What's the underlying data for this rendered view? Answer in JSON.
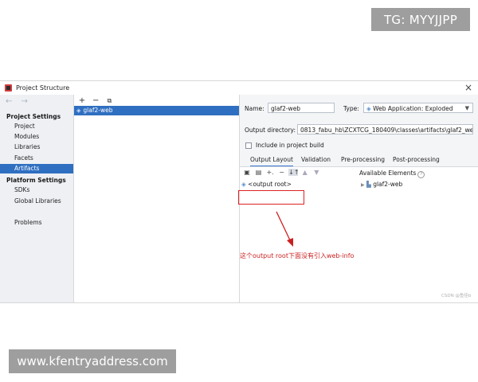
{
  "watermarks": {
    "top_right": "TG: MYYJJPP",
    "bottom_left": "www.kfentryaddress.com"
  },
  "window": {
    "title": "Project Structure",
    "close": "×"
  },
  "nav": {
    "arrows": "← →",
    "project_settings_header": "Project Settings",
    "project_settings": [
      {
        "label": "Project"
      },
      {
        "label": "Modules"
      },
      {
        "label": "Libraries"
      },
      {
        "label": "Facets"
      },
      {
        "label": "Artifacts",
        "selected": true
      }
    ],
    "platform_settings_header": "Platform Settings",
    "platform_settings": [
      {
        "label": "SDKs"
      },
      {
        "label": "Global Libraries"
      }
    ],
    "problems": "Problems"
  },
  "middle": {
    "toolbar": {
      "add": "+",
      "remove": "−",
      "copy": "⧉"
    },
    "selected_artifact": "glaf2-web"
  },
  "details": {
    "name_label": "Name:",
    "name_value": "glaf2-web",
    "type_label": "Type:",
    "type_value": "Web Application: Exploded",
    "output_dir_label": "Output directory:",
    "output_dir_value": "0813_fabu_hb\\ZCXTCG_180409\\classes\\artifacts\\glaf2_web",
    "include_in_build": "Include in project build",
    "include_checked": false,
    "tabs": [
      "Output Layout",
      "Validation",
      "Pre-processing",
      "Post-processing"
    ],
    "active_tab": "Output Layout"
  },
  "output_layout": {
    "available_elements_label": "Available Elements",
    "root_item": "<output root>",
    "available_item": "glaf2-web"
  },
  "annotation": {
    "text": "这个output root下面没有引入web-info",
    "color": "#cc1f1f"
  },
  "credit": "CSDN @鱼佳b"
}
